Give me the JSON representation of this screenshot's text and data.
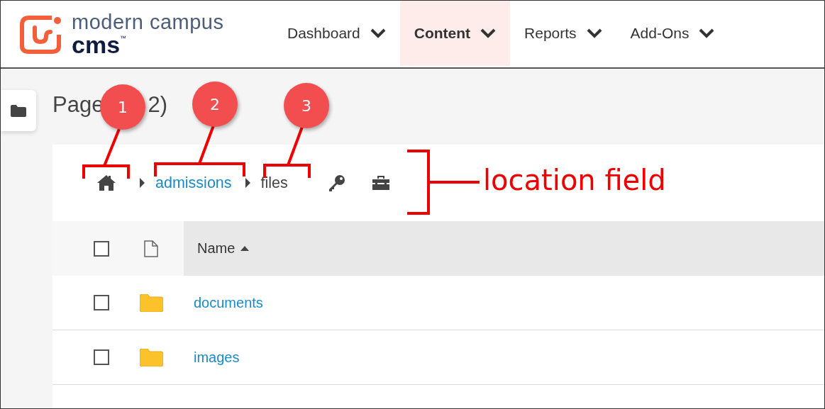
{
  "header": {
    "logo": {
      "line1": "modern campus",
      "line2": "cms",
      "trademark": "™"
    },
    "nav": [
      {
        "label": "Dashboard",
        "selected": false
      },
      {
        "label": "Content",
        "selected": true
      },
      {
        "label": "Reports",
        "selected": false
      },
      {
        "label": "Add-Ons",
        "selected": false
      }
    ]
  },
  "page_title_parts": [
    "Page",
    "2)"
  ],
  "breadcrumb": [
    {
      "kind": "home"
    },
    {
      "kind": "link",
      "label": "admissions"
    },
    {
      "kind": "current",
      "label": "files"
    }
  ],
  "table": {
    "select_all_checked": false,
    "columns": [
      {
        "label": "Name",
        "sort_ascending": true
      }
    ],
    "rows": [
      {
        "name": "documents",
        "checked": false
      },
      {
        "name": "images",
        "checked": false
      }
    ]
  },
  "annotations": {
    "callouts": [
      "1",
      "2",
      "3"
    ],
    "label": "location field"
  }
}
